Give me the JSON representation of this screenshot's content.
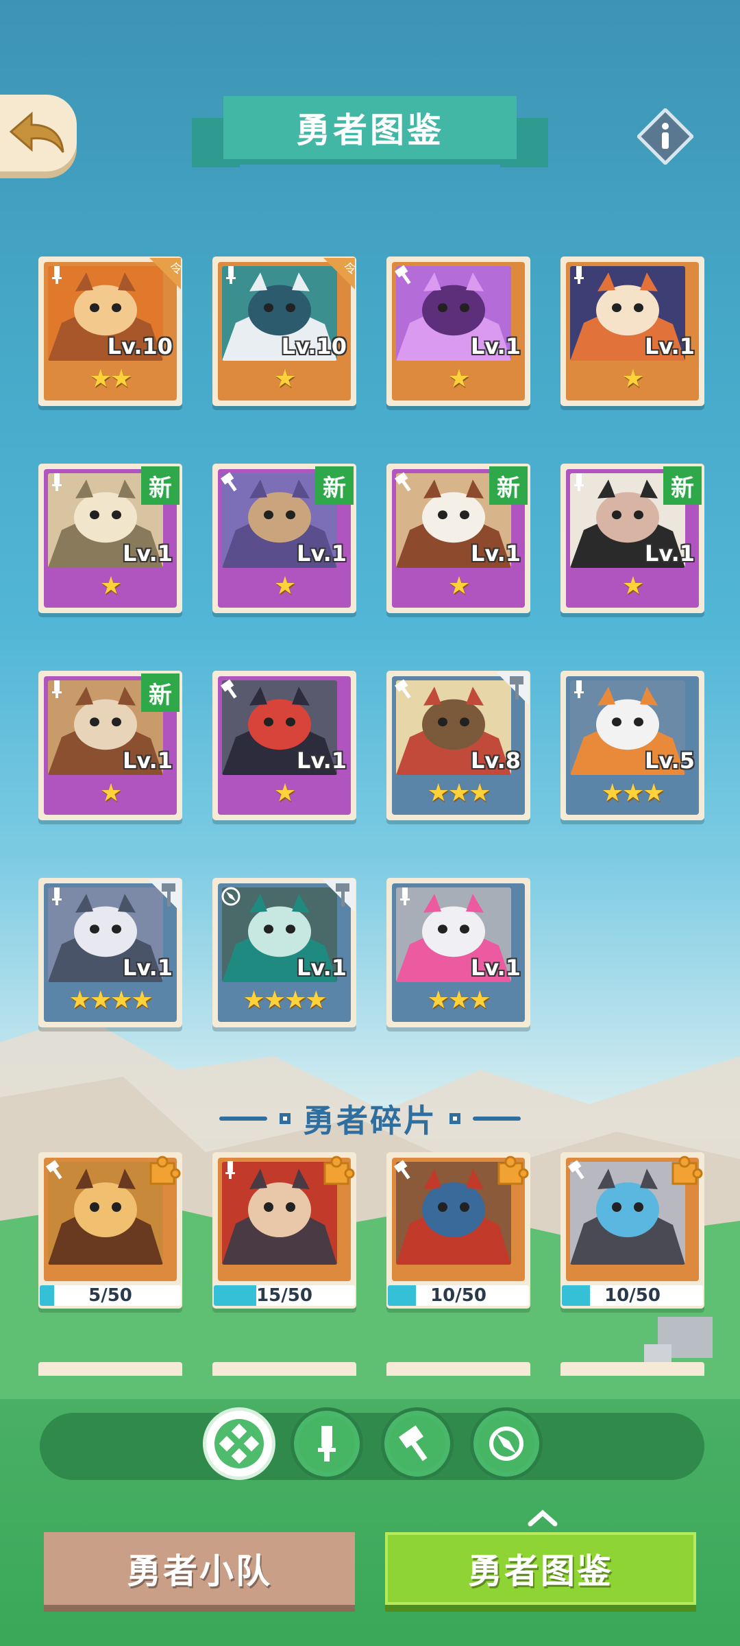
{
  "header": {
    "title": "勇者图鉴",
    "back_icon": "back-arrow-icon",
    "info_icon": "info-icon"
  },
  "heroes": [
    {
      "level": "Lv.10",
      "stars": "★★",
      "rarity": "orange",
      "role": "sword",
      "corner": "rank"
    },
    {
      "level": "Lv.10",
      "stars": "★",
      "rarity": "orange",
      "role": "sword",
      "corner": "rank"
    },
    {
      "level": "Lv.1",
      "stars": "★",
      "rarity": "orange",
      "role": "hammer"
    },
    {
      "level": "Lv.1",
      "stars": "★",
      "rarity": "orange",
      "role": "sword"
    },
    {
      "level": "Lv.1",
      "stars": "★",
      "rarity": "purple",
      "role": "sword",
      "tag": "新"
    },
    {
      "level": "Lv.1",
      "stars": "★",
      "rarity": "purple",
      "role": "hammer",
      "tag": "新"
    },
    {
      "level": "Lv.1",
      "stars": "★",
      "rarity": "purple",
      "role": "hammer",
      "tag": "新"
    },
    {
      "level": "Lv.1",
      "stars": "★",
      "rarity": "purple",
      "role": "sword",
      "tag": "新"
    },
    {
      "level": "Lv.1",
      "stars": "★",
      "rarity": "purple",
      "role": "sword",
      "tag": "新"
    },
    {
      "level": "Lv.1",
      "stars": "★",
      "rarity": "purple",
      "role": "hammer"
    },
    {
      "level": "Lv.8",
      "stars": "★★★",
      "rarity": "blue",
      "role": "hammer",
      "corner": "upgrade"
    },
    {
      "level": "Lv.5",
      "stars": "★★★",
      "rarity": "blue",
      "role": "sword"
    },
    {
      "level": "Lv.1",
      "stars": "★★★★",
      "rarity": "blue",
      "role": "sword",
      "corner": "upgrade"
    },
    {
      "level": "Lv.1",
      "stars": "★★★★",
      "rarity": "blue",
      "role": "compass",
      "corner": "upgrade"
    },
    {
      "level": "Lv.1",
      "stars": "★★★",
      "rarity": "blue",
      "role": "sword"
    }
  ],
  "shards_section": {
    "title": "勇者碎片",
    "items": [
      {
        "progress": "5/50",
        "ratio": 0.1,
        "role": "hammer"
      },
      {
        "progress": "15/50",
        "ratio": 0.3,
        "role": "sword"
      },
      {
        "progress": "10/50",
        "ratio": 0.2,
        "role": "hammer"
      },
      {
        "progress": "10/50",
        "ratio": 0.2,
        "role": "hammer"
      }
    ]
  },
  "filters": [
    {
      "icon": "all-roles-icon",
      "active": true
    },
    {
      "icon": "sword-icon",
      "active": false
    },
    {
      "icon": "hammer-icon",
      "active": false
    },
    {
      "icon": "compass-icon",
      "active": false
    }
  ],
  "tabs": {
    "team": "勇者小队",
    "dex": "勇者图鉴"
  },
  "colors": {
    "orange": "#de8a3e",
    "purple": "#b055c0",
    "blue": "#5a84a8",
    "new_tag": "#2fa84a",
    "accent_teal": "#43b7a6"
  }
}
